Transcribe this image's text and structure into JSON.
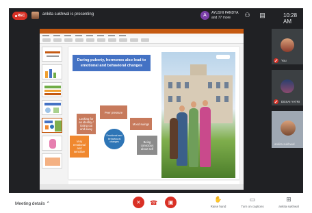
{
  "recording": {
    "label": "REC"
  },
  "header": {
    "presenter_text": "ankita sukhwal is presenting",
    "people_initial": "A",
    "people_line1": "AYUSHI PANDYA",
    "people_line2": "and 77 more",
    "time": "10:28 AM"
  },
  "slide": {
    "title": "During puberty, hormones also lead to emotional and behavioral changes",
    "boxes": {
      "peer_pressure": "Peer pressure",
      "identity": "Looking for an identity / Going out and away",
      "mood_swings": "Mood swings",
      "emotional": "Very emotional and sensitive",
      "conscious": "Being conscious about self",
      "center": "Emotional and behavioural changes"
    },
    "colors": {
      "title_bg": "#4472c4",
      "orange": "#f0882f",
      "brown": "#c77a5c",
      "grey": "#8c8c8c",
      "circle": "#2e75b6"
    }
  },
  "participants": [
    {
      "name": "You"
    },
    {
      "name": "DESAI YATRI"
    },
    {
      "name": "ankita sukhwal"
    }
  ],
  "bottom": {
    "meeting_details": "Meeting details",
    "raise_hand": "Raise hand",
    "captions": "Turn on captions",
    "presenting": "ankita sukhwal"
  }
}
